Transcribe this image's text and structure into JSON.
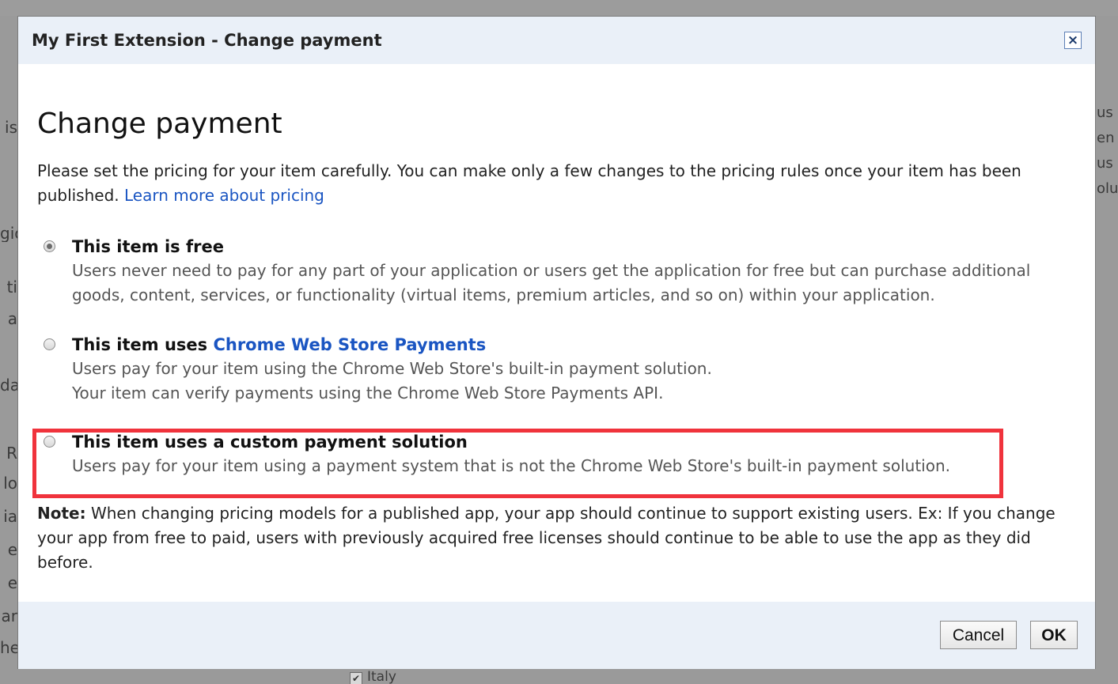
{
  "background": {
    "left_fragments": [
      "is",
      "gic",
      "ti",
      "a",
      "da",
      "R",
      "lo",
      "ia",
      "e",
      "e",
      "ar",
      "he"
    ],
    "right_fragments": [
      "us",
      "en",
      "us",
      "olu"
    ],
    "bottom_item": {
      "label": "Italy",
      "checked": true
    }
  },
  "dialog": {
    "title": "My First Extension - Change payment",
    "close_label": "×",
    "heading": "Change payment",
    "intro": "Please set the pricing for your item carefully. You can make only a few changes to the pricing rules once your item has been published.",
    "intro_link": "Learn more about pricing",
    "options": [
      {
        "title": "This item is free",
        "title_link": "",
        "desc_lines": [
          "Users never need to pay for any part of your application or users get the application for free but can purchase additional goods, content, services, or functionality (virtual items, premium articles, and so on) within your application."
        ],
        "selected": true
      },
      {
        "title": "This item uses",
        "title_link": "Chrome Web Store Payments",
        "desc_lines": [
          "Users pay for your item using the Chrome Web Store's built-in payment solution.",
          "Your item can verify payments using the Chrome Web Store Payments API."
        ],
        "selected": false
      },
      {
        "title": "This item uses a custom payment solution",
        "title_link": "",
        "desc_lines": [
          "Users pay for your item using a payment system that is not the Chrome Web Store's built-in payment solution."
        ],
        "selected": false
      }
    ],
    "note_label": "Note:",
    "note_text": "When changing pricing models for a published app, your app should continue to support existing users. Ex: If you change your app from free to paid, users with previously acquired free licenses should continue to be able to use the app as they did before.",
    "buttons": {
      "cancel": "Cancel",
      "ok": "OK"
    }
  },
  "colors": {
    "highlight": "#f0333c",
    "link": "#1a55c2",
    "header_bg": "#eaf0f8"
  }
}
